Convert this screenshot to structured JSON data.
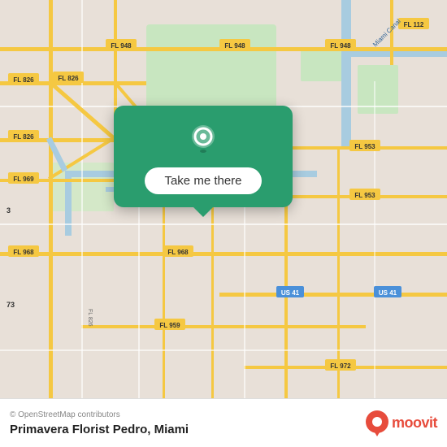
{
  "map": {
    "attribution": "© OpenStreetMap contributors",
    "background_color": "#e8e0d8",
    "accent_color": "#2a9d6e"
  },
  "popup": {
    "button_label": "Take me there",
    "pin_color": "#ffffff"
  },
  "bottom_bar": {
    "place_name": "Primavera Florist Pedro",
    "city": "Miami",
    "attribution": "© OpenStreetMap contributors"
  },
  "moovit": {
    "logo_text": "moovit"
  },
  "road_labels": [
    "FL 826",
    "FL 826",
    "FL 826",
    "FL 948",
    "FL 948",
    "FL 948",
    "FL 953",
    "FL 953",
    "FL 968",
    "FL 968",
    "FL 969",
    "FL 959",
    "FL 972",
    "FL 112",
    "US 41",
    "US 41",
    "Miami Canal"
  ]
}
